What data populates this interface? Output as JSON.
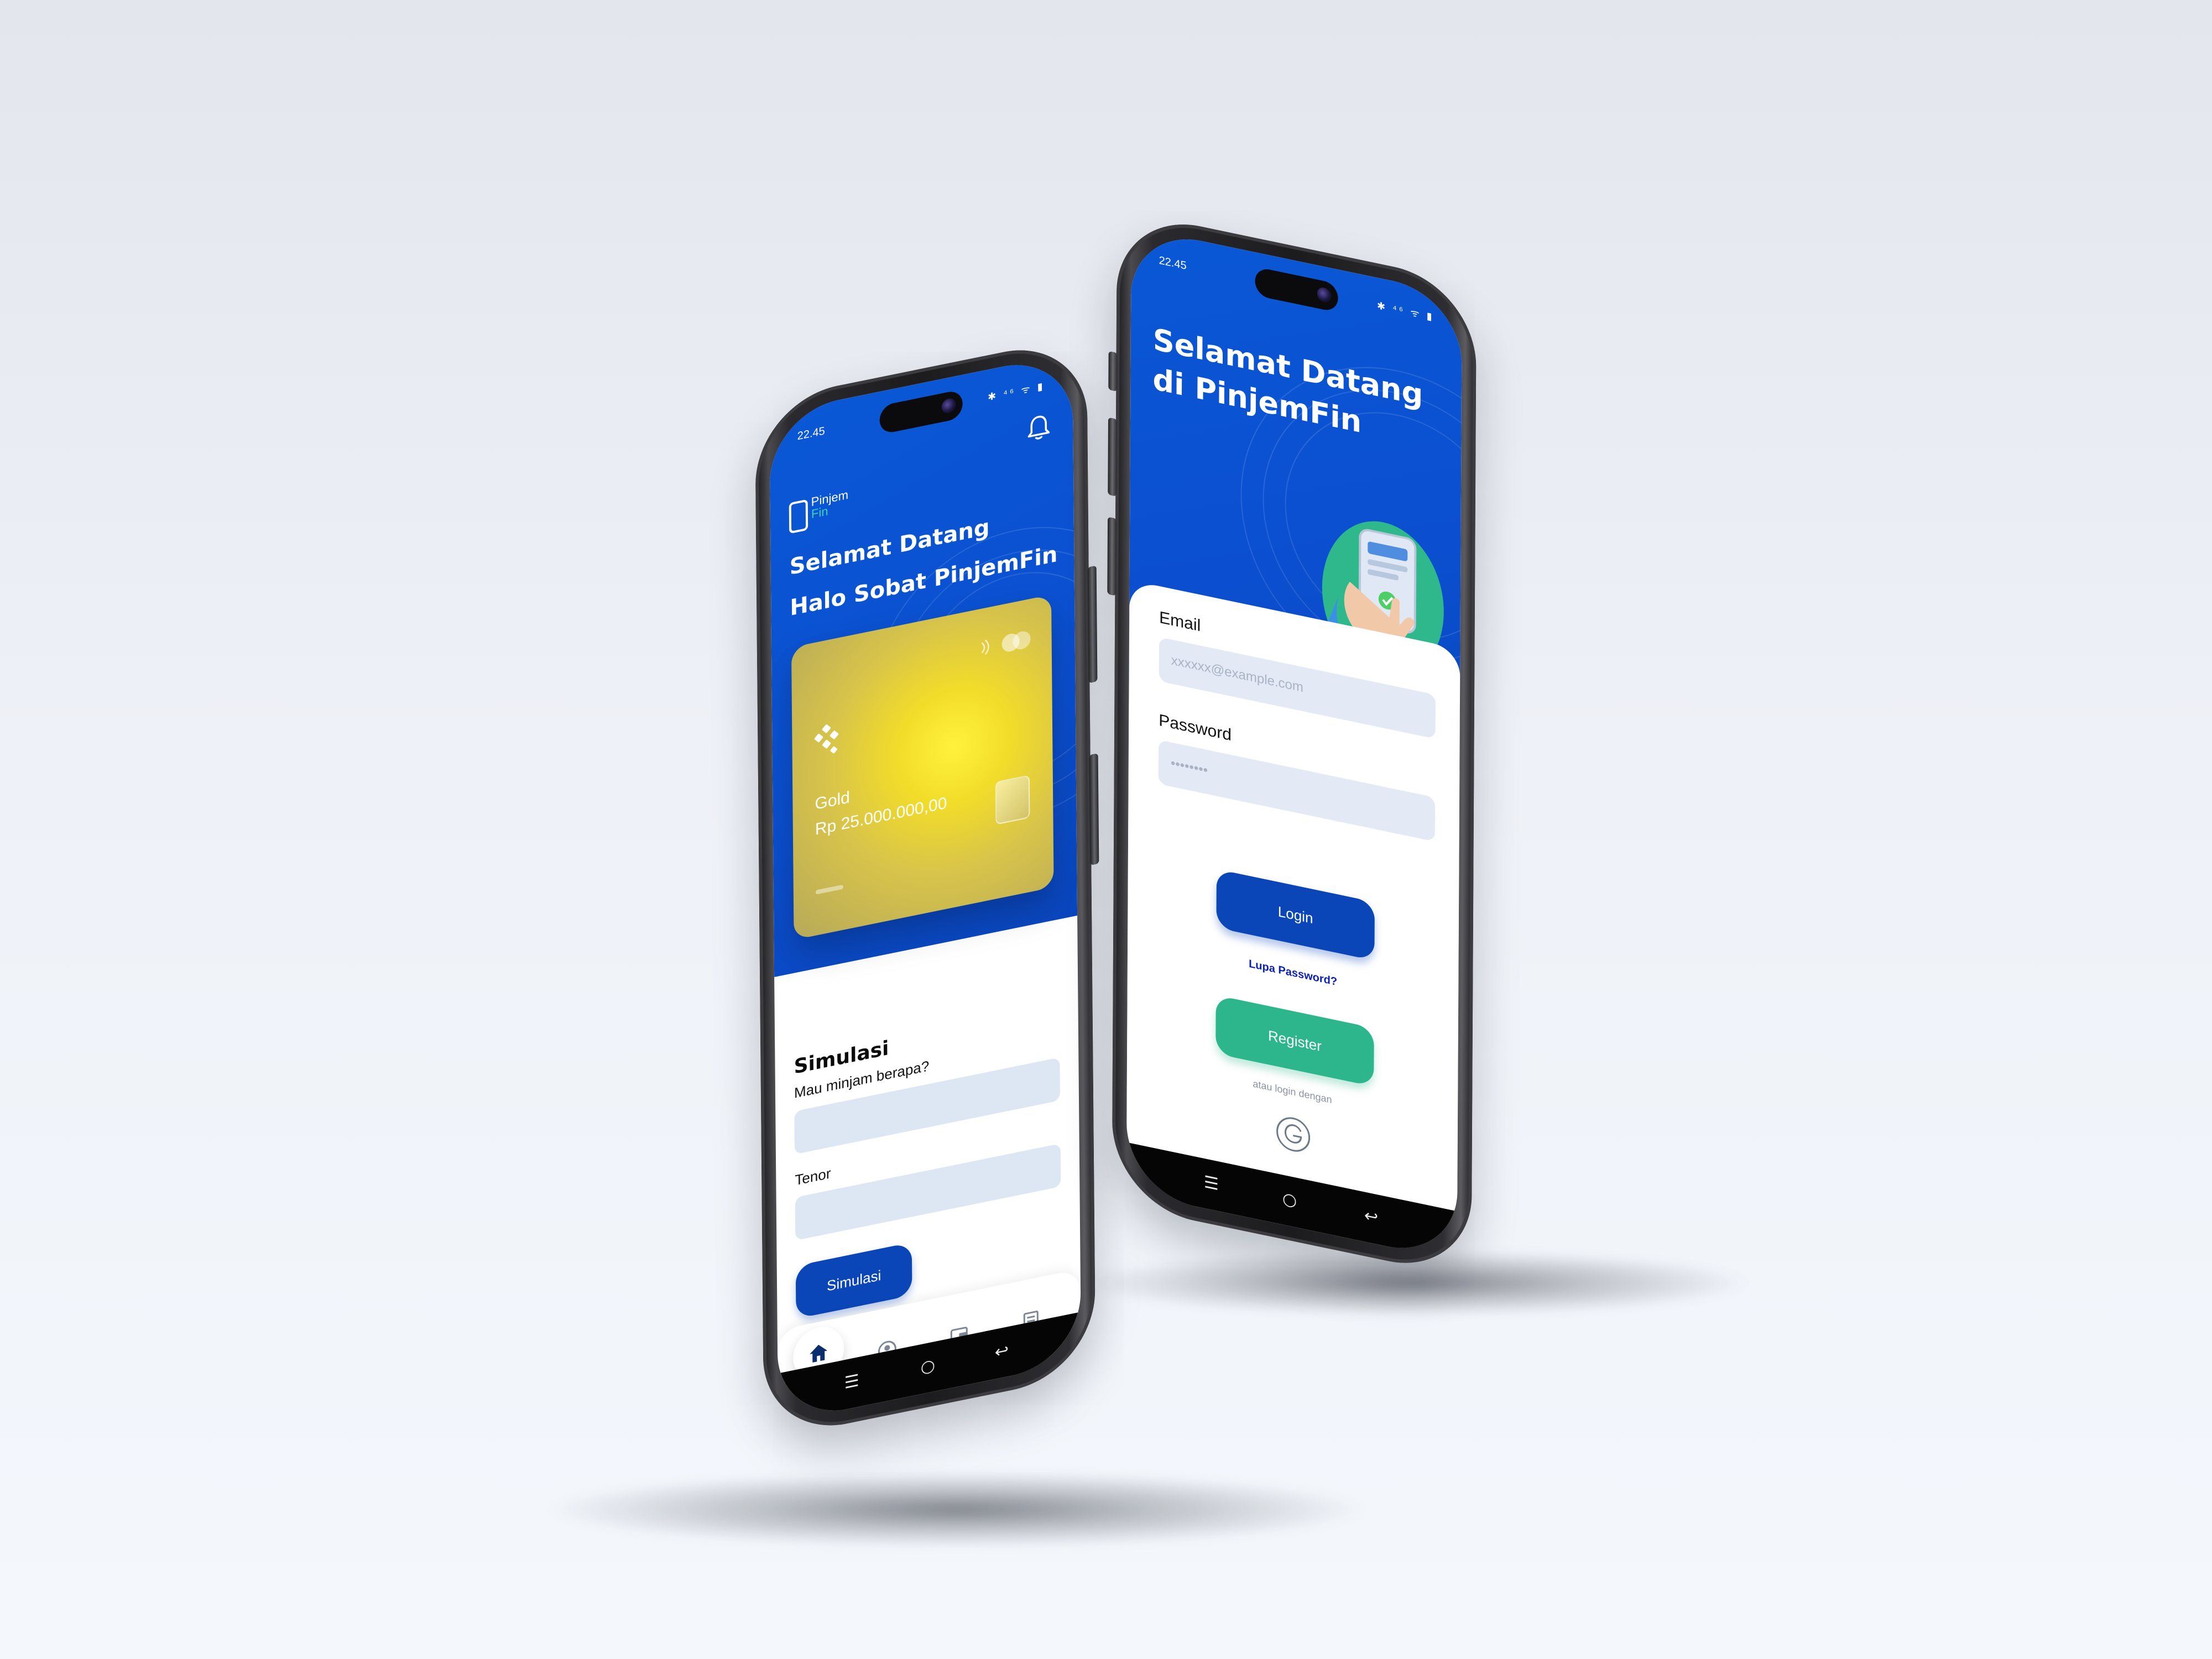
{
  "phone_left": {
    "status": {
      "time": "22.45",
      "icons": "✱ ⁴⁶ ᯤ ▮"
    },
    "logo": {
      "line1": "Pinjem",
      "line2": "Fin"
    },
    "greeting": {
      "title": "Selamat Datang",
      "subtitle": "Halo Sobat PinjemFin"
    },
    "card": {
      "tier": "Gold",
      "amount": "Rp 25.000.000,00"
    },
    "simulation": {
      "title": "Simulasi",
      "amount_label": "Mau minjam berapa?",
      "tenor_label": "Tenor",
      "button": "Simulasi"
    },
    "tabs": [
      "home-icon",
      "profile-icon",
      "wallet-icon",
      "list-icon"
    ],
    "nav": {
      "recents": "☰",
      "home": "○",
      "back": "↩"
    }
  },
  "phone_right": {
    "status": {
      "time": "22.45",
      "icons": "✱ ⁴⁶ ᯤ ▮"
    },
    "welcome": "Selamat Datang di PinjemFin",
    "email_label": "Email",
    "email_placeholder": "xxxxxx@example.com",
    "password_label": "Password",
    "password_placeholder": "••••••••",
    "login_button": "Login",
    "forgot_password": "Lupa Password?",
    "register_button": "Register",
    "alt_login": "atau login dengan",
    "nav": {
      "recents": "☰",
      "home": "○",
      "back": "↩"
    }
  },
  "colors": {
    "primary_blue": "#0b4fd0",
    "button_blue": "#0b46b8",
    "register_green": "#2db68b",
    "card_gold": "#f2dc2a",
    "field_bg": "#dde6f3"
  }
}
